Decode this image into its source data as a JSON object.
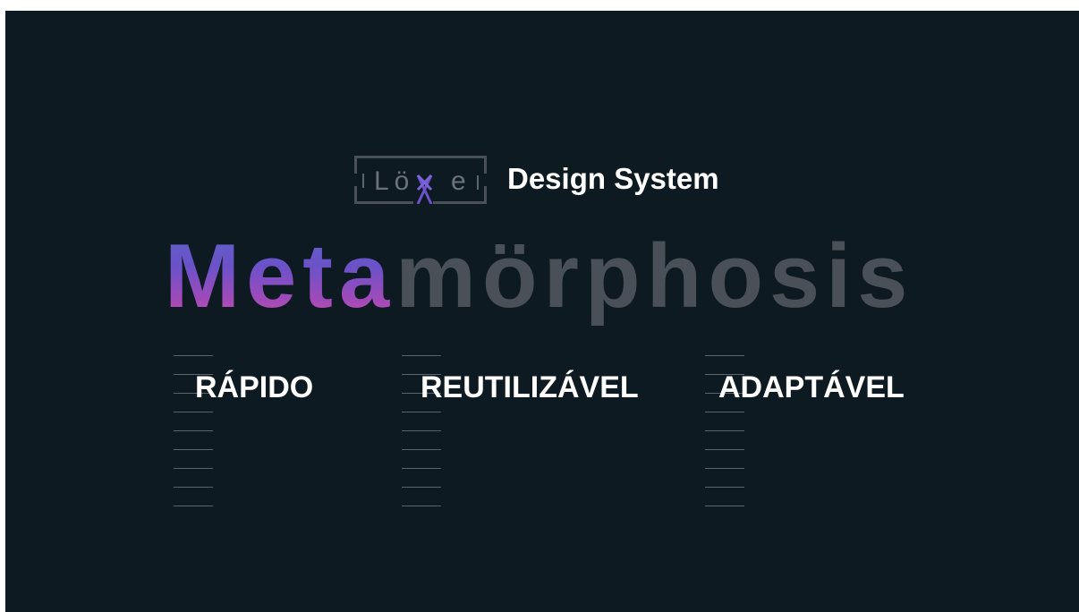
{
  "logo": {
    "text_left": "Lö",
    "text_x": "X",
    "text_right": "e",
    "alt": "Löxe"
  },
  "header": {
    "subtitle": "Design System"
  },
  "hero": {
    "highlight": "Meta",
    "rest": "mörphosis"
  },
  "pillars": [
    {
      "label": "RÁPIDO"
    },
    {
      "label": "REUTILIZÁVEL"
    },
    {
      "label": "ADAPTÁVEL"
    }
  ],
  "colors": {
    "background": "#0e1a22",
    "text": "#ffffff",
    "muted": "#4a5058",
    "gradient_start": "#5f63c8",
    "gradient_end": "#c95aa8",
    "rule": "#5a646c"
  }
}
